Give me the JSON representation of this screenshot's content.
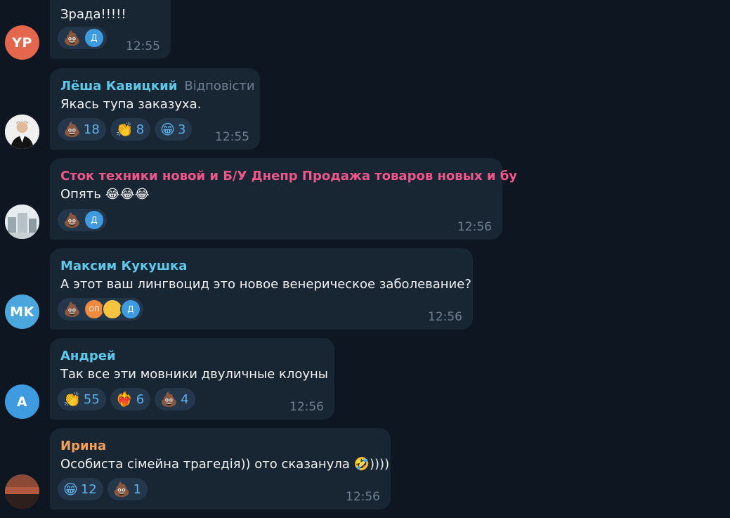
{
  "messages": [
    {
      "avatar": {
        "initials": "YP",
        "color": "#e4664d"
      },
      "text": "Зрада!!!!!",
      "reactions": [
        {
          "emoji": "💩",
          "label": "",
          "users": [
            "Д"
          ]
        }
      ],
      "time": "12:55"
    },
    {
      "sender": "Лёша Кавицкий",
      "sender_color": "#5fc7e8",
      "reply_label": "Відповісти",
      "avatar": {
        "initials": "",
        "color": "#d9d9d9"
      },
      "text": "Якась тупа заказуха.",
      "reactions": [
        {
          "emoji": "💩",
          "label": "18"
        },
        {
          "emoji": "👏",
          "label": "8"
        },
        {
          "emoji": "😁",
          "label": "3"
        }
      ],
      "time": "12:55"
    },
    {
      "sender": "Сток техники новой и Б/У Днепр Продажа товаров новых и бу",
      "sender_color": "#f0568a",
      "avatar": {
        "initials": "",
        "color": "#cfd8dc"
      },
      "text": "Опять 😂😂😂",
      "reactions": [
        {
          "emoji": "💩",
          "label": "",
          "users": [
            "Д"
          ]
        }
      ],
      "time": "12:56"
    },
    {
      "sender": "Максим Кукушка",
      "sender_color": "#5fc7e8",
      "avatar": {
        "initials": "MK",
        "color": "#4aa6dd"
      },
      "text": "А этот ваш лингвоцид это новое венерическое заболевание?",
      "reactions": [
        {
          "emoji": "💩",
          "label": "",
          "users": [
            "ОП",
            "",
            "Д"
          ]
        }
      ],
      "time": "12:56"
    },
    {
      "sender": "Андрей",
      "sender_color": "#5fc7e8",
      "avatar": {
        "initials": "A",
        "color": "#3f9be0"
      },
      "text": "Так все эти мовники двуличные клоуны",
      "reactions": [
        {
          "emoji": "👏",
          "label": "55"
        },
        {
          "emoji": "❤️‍🔥",
          "label": "6"
        },
        {
          "emoji": "💩",
          "label": "4"
        }
      ],
      "time": "12:56"
    },
    {
      "sender": "Ирина",
      "sender_color": "#f2a05a",
      "avatar": {
        "initials": "",
        "color": "#6b3a2e"
      },
      "text": "Особиста сімейна трагедія)) ото сказанула 🤣))))",
      "reactions": [
        {
          "emoji": "😁",
          "label": "12"
        },
        {
          "emoji": "💩",
          "label": "1"
        }
      ],
      "time": "12:56"
    }
  ]
}
